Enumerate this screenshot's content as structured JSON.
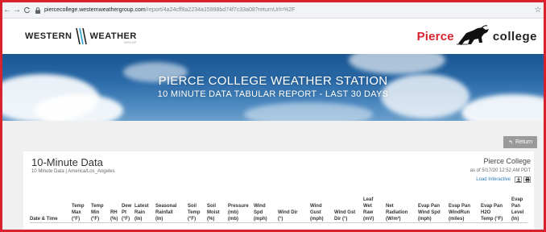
{
  "browser": {
    "back": "←",
    "forward": "→",
    "reload": "C",
    "url_host": "piercecollege.westernweathergroup.com",
    "url_path": "/report/4a24cff8a2234a15998bd74f7c33a08?returnUrl=%2F",
    "star": "☆"
  },
  "header": {
    "ww_left": "WESTERN",
    "ww_right": "WEATHER",
    "ww_group": "GROUP",
    "pierce": "Pierce",
    "college": "college"
  },
  "banner": {
    "title": "PIERCE COLLEGE WEATHER STATION",
    "subtitle": "10 MINUTE DATA TABULAR REPORT - LAST 30 DAYS"
  },
  "return_label": "Return",
  "report": {
    "title": "10-Minute Data",
    "meta": "10 Minute Data | America/Los_Angeles",
    "station": "Pierce College",
    "as_of": "as of 5/17/20 12:52 AM PDT",
    "load_interactive": "Load Interactive"
  },
  "table": {
    "columns": [
      {
        "lines": [
          "",
          "",
          "",
          "Date & Time"
        ]
      },
      {
        "lines": [
          "",
          "Temp",
          "Max",
          "(°F)"
        ]
      },
      {
        "lines": [
          "",
          "Temp",
          "Min",
          "(°F)"
        ]
      },
      {
        "lines": [
          "",
          "",
          "RH",
          "(%)"
        ]
      },
      {
        "lines": [
          "",
          "Dew",
          "Pt",
          "(°F)"
        ]
      },
      {
        "lines": [
          "",
          "Latest",
          "Rain",
          "(In)"
        ]
      },
      {
        "lines": [
          "",
          "Seasonal",
          "Rainfall",
          "(In)"
        ]
      },
      {
        "lines": [
          "",
          "Soil",
          "Temp",
          "(°F)"
        ]
      },
      {
        "lines": [
          "",
          "Soil",
          "Moist",
          "(%)"
        ]
      },
      {
        "lines": [
          "",
          "Pressure",
          "(mb)",
          "(mb)"
        ]
      },
      {
        "lines": [
          "",
          "Wind",
          "Spd",
          "(mph)"
        ]
      },
      {
        "lines": [
          "",
          "",
          "Wind Dir",
          "(°)"
        ]
      },
      {
        "lines": [
          "",
          "Wind",
          "Gust",
          "(mph)"
        ]
      },
      {
        "lines": [
          "",
          "",
          "Wind Gst",
          "Dir (°)"
        ]
      },
      {
        "lines": [
          "Leaf",
          "Wet",
          "Raw",
          "(mV)"
        ]
      },
      {
        "lines": [
          "",
          "Net",
          "Radiation",
          "(W/m²)"
        ]
      },
      {
        "lines": [
          "",
          "Evap Pan",
          "Wind Spd",
          "(mph)"
        ]
      },
      {
        "lines": [
          "",
          "Evap Pan",
          "WindRun",
          "(miles)"
        ]
      },
      {
        "lines": [
          "",
          "Evap Pan",
          "H2O",
          "Temp (°F)"
        ]
      },
      {
        "lines": [
          "Evap",
          "Pan",
          "Level",
          "(In)"
        ]
      }
    ]
  },
  "colors": {
    "frame": "#d8232f",
    "pierce_red": "#d8232f",
    "banner_top": "#1a5591",
    "link": "#2a7ab0"
  }
}
